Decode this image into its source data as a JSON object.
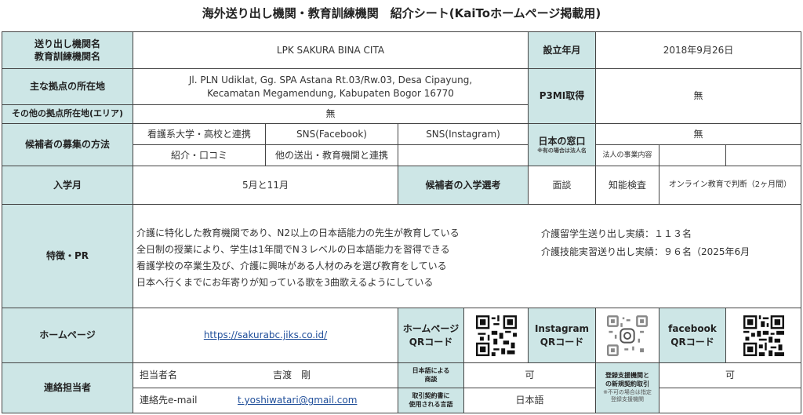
{
  "title": "海外送り出し機関・教育訓練機関　紹介シート(KaiToホームページ掲載用)",
  "org": {
    "label_line1": "送り出し機関名",
    "label_line2": "教育訓練機関名",
    "value": "LPK SAKURA BINA CITA"
  },
  "established": {
    "label": "設立年月",
    "value": "2018年9月26日"
  },
  "main_location": {
    "label": "主な拠点の所在地",
    "line1": "Jl. PLN Udiklat, Gg. SPA Astana Rt.03/Rw.03, Desa Cipayung,",
    "line2": "Kecamatan Megamendung, Kabupaten Bogor 16770"
  },
  "p3mi": {
    "label": "P3MI取得",
    "value": "無"
  },
  "other_location": {
    "label": "その他の拠点所在地(エリア)",
    "value": "無"
  },
  "recruit": {
    "label": "候補者の募集の方法",
    "m1": "看護系大学・高校と連携",
    "m2": "SNS(Facebook)",
    "m3": "SNS(Instagram)",
    "m4": "紹介・口コミ",
    "m5": "他の送出・教育機関と連携",
    "m6": ""
  },
  "japan_window": {
    "label": "日本の窓口",
    "note": "※有の場合は法人名",
    "value": "無",
    "biz_label": "法人の事業内容"
  },
  "enroll": {
    "label": "入学月",
    "value": "5月と11月"
  },
  "selection": {
    "label": "候補者の入学選考",
    "v1": "面談",
    "v2": "知能検査",
    "v3": "オンライン教育で判断（2ヶ月間）"
  },
  "features": {
    "label": "特徴・PR",
    "lines": [
      "介護に特化した教育機関であり、N2以上の日本語能力の先生が教育している",
      "全日制の授業により、学生は1年間でN３レベルの日本語能力を習得できる",
      "看護学校の卒業生及び、介護に興味がある人材のみを選び教育をしている",
      "日本へ行くまでにお年寄りが知っている歌を3曲歌えるようにしている"
    ],
    "stats": [
      "介護留学生送り出し実績：１１３名",
      "介護技能実習送り出し実績：９６名（2025年6月"
    ]
  },
  "homepage": {
    "label": "ホームページ",
    "url": "https://sakurabc.jiks.co.id/",
    "qr1": "ホームページ",
    "qr2": "QRコード"
  },
  "instagram": {
    "qr1": "Instagram",
    "qr2": "QRコード"
  },
  "facebook": {
    "qr1": "facebook",
    "qr2": "QRコード"
  },
  "contact": {
    "label": "連絡担当者",
    "person_label": "担当者名",
    "person_name": "吉渡　剛",
    "email_label": "連絡先e-mail",
    "email": "t.yoshiwatari@gmail.com",
    "jp_talk_l1": "日本語による",
    "jp_talk_l2": "商談",
    "jp_talk_value": "可",
    "contract_l1": "取引契約書に",
    "contract_l2": "使用される言語",
    "contract_value": "日本語",
    "support_l1": "登録支援機関と",
    "support_l2": "の新規契約取引",
    "support_note1": "※不可の場合は指定",
    "support_note2": "登録支援機関",
    "support_value": "可"
  },
  "colors": {
    "header_bg": "#cde6e6",
    "border": "#444444",
    "link": "#1f4e9a"
  }
}
